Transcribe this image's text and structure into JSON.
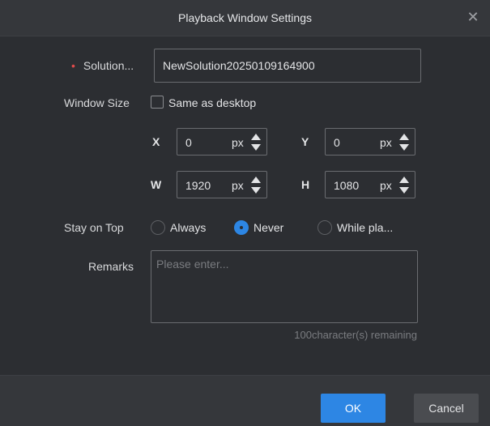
{
  "dialog": {
    "title": "Playback Window Settings",
    "close_icon": "close-icon"
  },
  "solution": {
    "label": "Solution...",
    "required_mark": "•",
    "value": "NewSolution20250109164900"
  },
  "window_size": {
    "label": "Window Size",
    "checkbox_label": "Same as desktop",
    "checked": false,
    "x": {
      "letter": "X",
      "value": "0",
      "unit": "px"
    },
    "y": {
      "letter": "Y",
      "value": "0",
      "unit": "px"
    },
    "w": {
      "letter": "W",
      "value": "1920",
      "unit": "px"
    },
    "h": {
      "letter": "H",
      "value": "1080",
      "unit": "px"
    }
  },
  "stay_on_top": {
    "label": "Stay on Top",
    "options": [
      "Always",
      "Never",
      "While pla..."
    ],
    "selected": "Never"
  },
  "remarks": {
    "label": "Remarks",
    "placeholder": "Please enter...",
    "counter": "100character(s) remaining"
  },
  "buttons": {
    "ok": "OK",
    "cancel": "Cancel"
  },
  "colors": {
    "accent": "#2d86e4",
    "required": "#e04b4b",
    "background": "#2c2e32"
  }
}
